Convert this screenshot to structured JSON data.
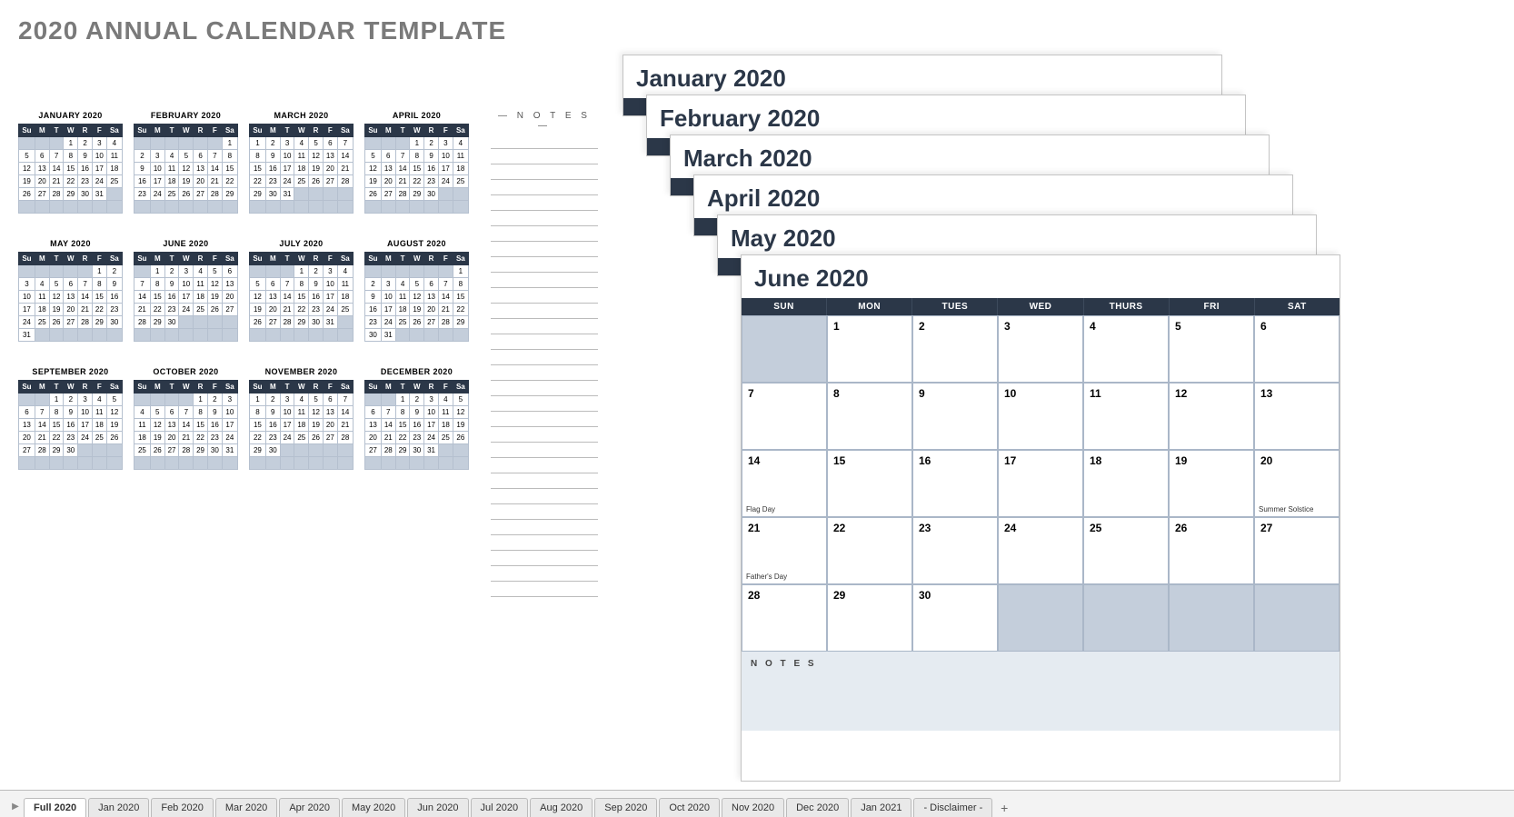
{
  "page_title": "2020 ANNUAL CALENDAR TEMPLATE",
  "notes_heading": "— N O T E S —",
  "dow_short": [
    "Su",
    "M",
    "T",
    "W",
    "R",
    "F",
    "Sa"
  ],
  "dow_long": [
    "SUN",
    "MON",
    "TUES",
    "WED",
    "THURS",
    "FRI",
    "SAT"
  ],
  "months_mini": [
    {
      "title": "JANUARY 2020",
      "start": 3,
      "days": 31
    },
    {
      "title": "FEBRUARY 2020",
      "start": 6,
      "days": 29
    },
    {
      "title": "MARCH 2020",
      "start": 0,
      "days": 31
    },
    {
      "title": "APRIL 2020",
      "start": 3,
      "days": 30
    },
    {
      "title": "MAY 2020",
      "start": 5,
      "days": 31
    },
    {
      "title": "JUNE 2020",
      "start": 1,
      "days": 30
    },
    {
      "title": "JULY 2020",
      "start": 3,
      "days": 31
    },
    {
      "title": "AUGUST 2020",
      "start": 6,
      "days": 31
    },
    {
      "title": "SEPTEMBER 2020",
      "start": 2,
      "days": 30
    },
    {
      "title": "OCTOBER 2020",
      "start": 4,
      "days": 31
    },
    {
      "title": "NOVEMBER 2020",
      "start": 0,
      "days": 30
    },
    {
      "title": "DECEMBER 2020",
      "start": 2,
      "days": 31
    }
  ],
  "stack_titles": [
    "January 2020",
    "February 2020",
    "March 2020",
    "April 2020",
    "May 2020",
    "June 2020"
  ],
  "june": {
    "title": "June 2020",
    "notes_label": "N O T E S",
    "start": 1,
    "days": 30,
    "events": {
      "14": "Flag Day",
      "20": "Summer Solstice",
      "21": "Father's Day"
    }
  },
  "tabs": [
    "Full 2020",
    "Jan 2020",
    "Feb 2020",
    "Mar 2020",
    "Apr 2020",
    "May 2020",
    "Jun 2020",
    "Jul 2020",
    "Aug 2020",
    "Sep 2020",
    "Oct 2020",
    "Nov 2020",
    "Dec 2020",
    "Jan 2021",
    "- Disclaimer -"
  ],
  "active_tab": 0,
  "add_tab_label": "+"
}
